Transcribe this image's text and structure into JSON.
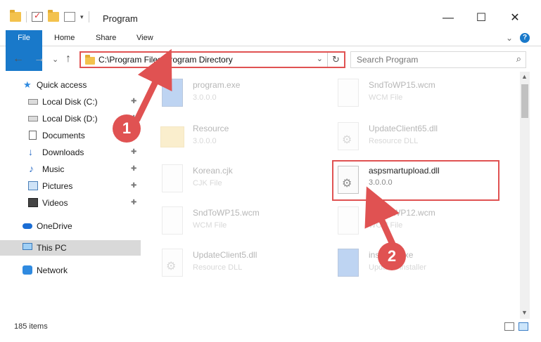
{
  "window": {
    "title": "Program",
    "minimize": "—",
    "maximize": "☐",
    "close": "✕"
  },
  "ribbon": {
    "tabs": [
      "File",
      "Home",
      "Share",
      "View"
    ],
    "expand": "⌄",
    "help": "?"
  },
  "nav": {
    "back": "←",
    "forward": "→",
    "recent": "⌄",
    "up": "↑"
  },
  "address": {
    "path": "C:\\Program Files\\Program Directory",
    "dropdown": "⌄",
    "refresh": "↻"
  },
  "search": {
    "placeholder": "Search Program",
    "icon": "⌕"
  },
  "sidebar": {
    "items": [
      {
        "label": "Quick access",
        "icon": "star-icon",
        "pinned": false
      },
      {
        "label": "Local Disk (C:)",
        "icon": "disk-icon",
        "pinned": true
      },
      {
        "label": "Local Disk (D:)",
        "icon": "disk-icon",
        "pinned": true
      },
      {
        "label": "Documents",
        "icon": "documents-icon",
        "pinned": true
      },
      {
        "label": "Downloads",
        "icon": "downloads-icon",
        "pinned": true
      },
      {
        "label": "Music",
        "icon": "music-icon",
        "pinned": true
      },
      {
        "label": "Pictures",
        "icon": "pictures-icon",
        "pinned": true
      },
      {
        "label": "Videos",
        "icon": "videos-icon",
        "pinned": true
      },
      {
        "label": "OneDrive",
        "icon": "onedrive-icon",
        "pinned": false
      },
      {
        "label": "This PC",
        "icon": "pc-icon",
        "pinned": false,
        "selected": true
      },
      {
        "label": "Network",
        "icon": "network-icon",
        "pinned": false
      }
    ],
    "pin_glyph": "📌"
  },
  "files": [
    {
      "name": "program.exe",
      "sub": "3.0.0.0",
      "icon": "exe-icon"
    },
    {
      "name": "SndToWP15.wcm",
      "sub": "WCM File",
      "icon": "file-icon"
    },
    {
      "name": "Resource",
      "sub": "3.0.0.0",
      "icon": "folder-icon"
    },
    {
      "name": "UpdateClient65.dll",
      "sub": "Resource DLL",
      "icon": "dll-icon"
    },
    {
      "name": "Korean.cjk",
      "sub": "CJK File",
      "icon": "file-icon"
    },
    {
      "name": "aspsmartupload.dll",
      "sub": "3.0.0.0",
      "icon": "dll-icon"
    },
    {
      "name": "SndToWP15.wcm",
      "sub": "WCM File",
      "icon": "file-icon"
    },
    {
      "name": "SndToWP12.wcm",
      "sub": "WCM File",
      "icon": "file-icon"
    },
    {
      "name": "UpdateClient5.dll",
      "sub": "Resource DLL",
      "icon": "dll-icon"
    },
    {
      "name": "installer.exe",
      "sub": "Updates installer",
      "icon": "exe-icon"
    }
  ],
  "status": {
    "items_count": "185 items"
  },
  "annotations": {
    "step1": "1",
    "step2": "2",
    "color": "#e05252"
  },
  "colors": {
    "accent": "#1979ca",
    "highlight": "#e05252"
  }
}
